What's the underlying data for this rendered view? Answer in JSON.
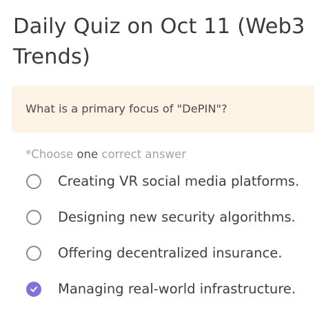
{
  "quiz": {
    "title": "Daily Quiz on Oct 11 (Web3 Trends)",
    "question": "What is a primary focus of \"DePIN\"?",
    "instruction": {
      "prefix": "*Choose ",
      "emphasis": "one",
      "suffix": " correct answer"
    },
    "options": [
      {
        "label": "Creating VR social media platforms.",
        "selected": false
      },
      {
        "label": "Designing new security algorithms.",
        "selected": false
      },
      {
        "label": "Offering decentralized insurance.",
        "selected": false
      },
      {
        "label": "Managing real-world infrastructure.",
        "selected": true
      }
    ]
  },
  "colors": {
    "accent": "#7c74d8",
    "question_background": "#fdf4e6",
    "muted_text": "#a3a3a3"
  },
  "icons": {
    "unselected": "radio-unchecked-icon",
    "selected": "check-circle-icon"
  }
}
